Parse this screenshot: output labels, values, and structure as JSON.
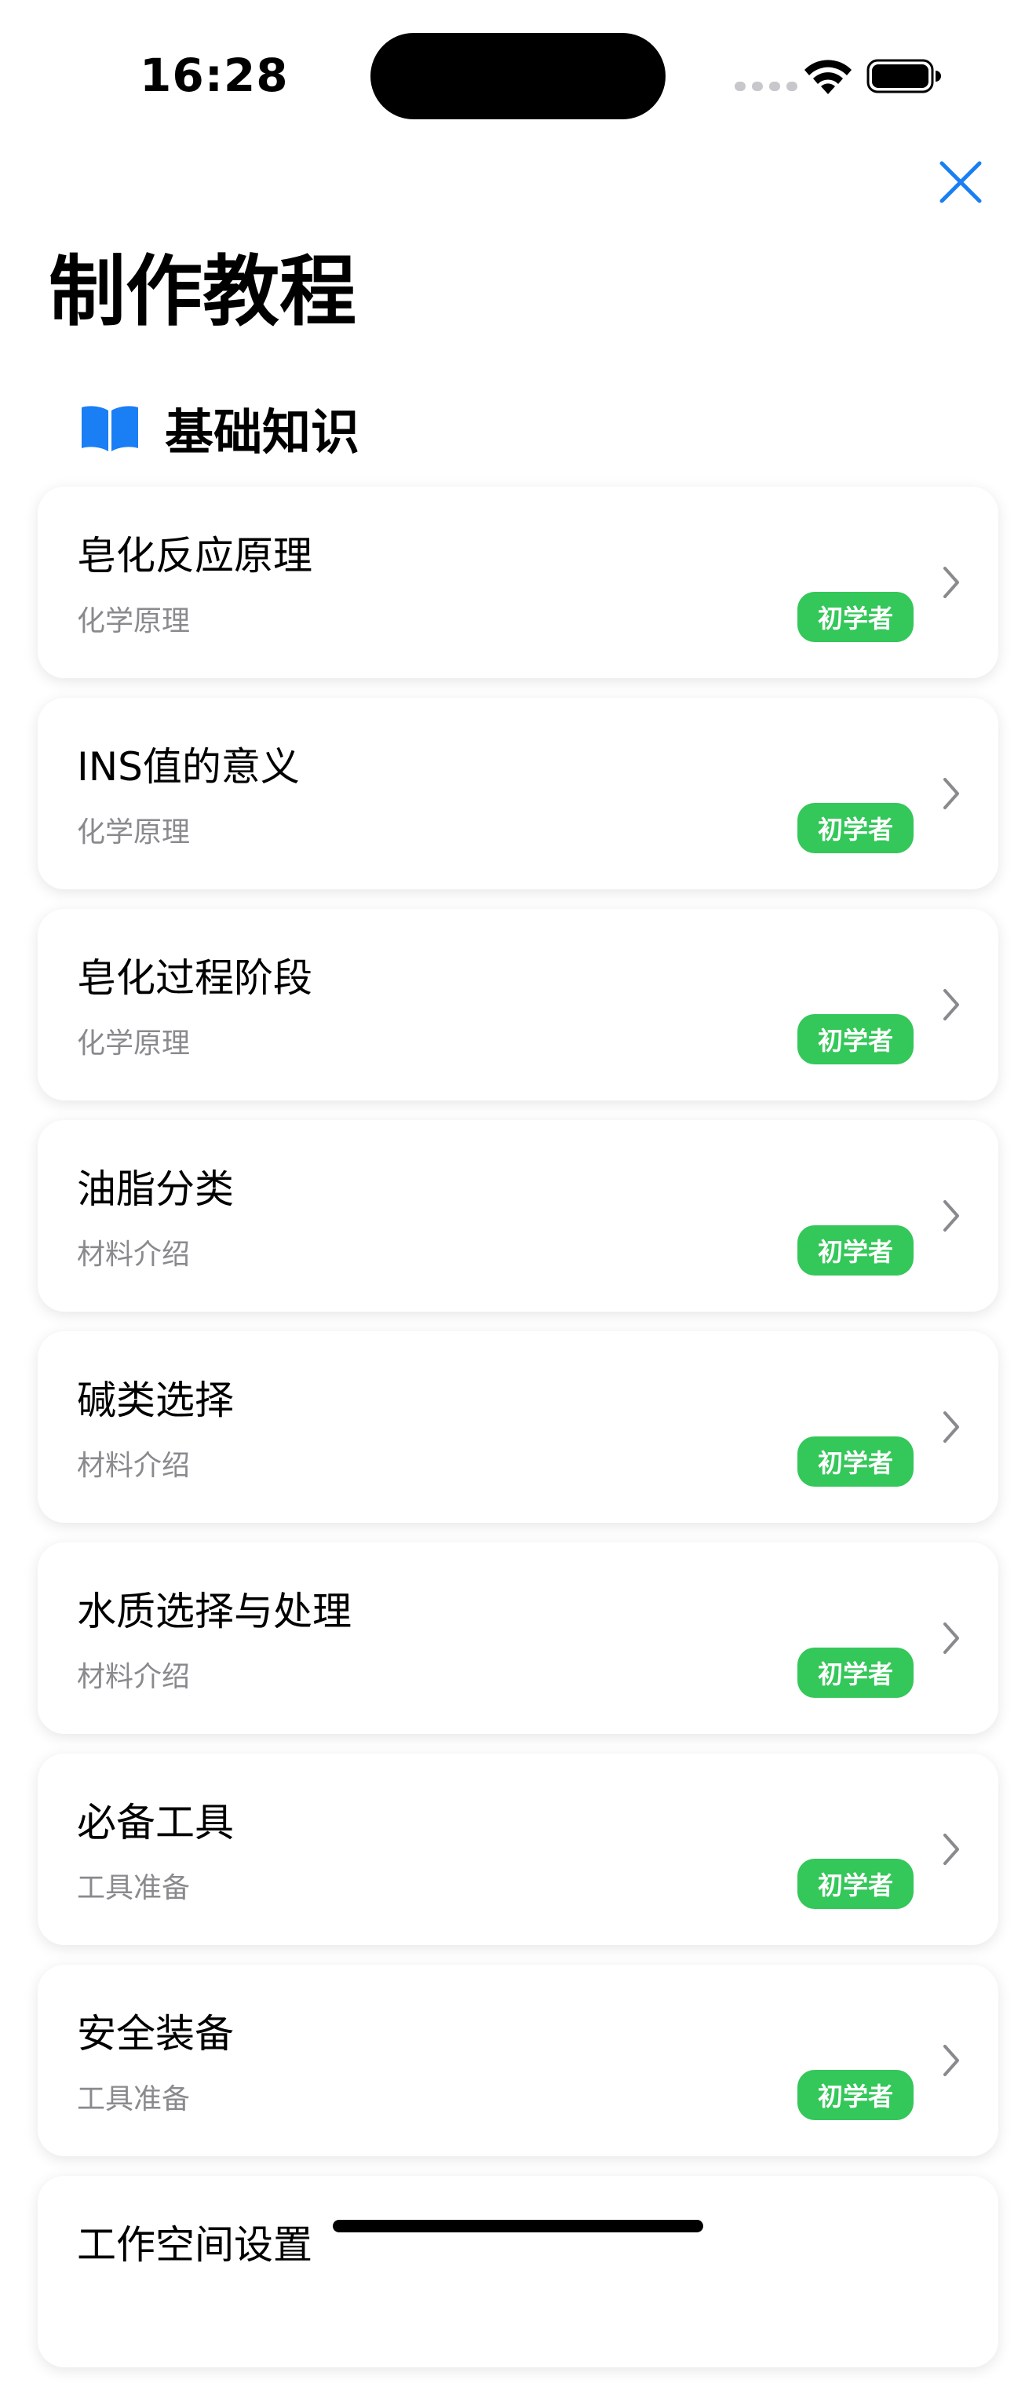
{
  "status_bar": {
    "time": "16:28"
  },
  "header": {
    "title": "制作教程",
    "close_icon": "close-icon"
  },
  "section": {
    "icon": "book-icon",
    "title": "基础知识"
  },
  "colors": {
    "accent": "#1a7ef5",
    "badge": "#34c759",
    "subtitle": "#8a8a8e"
  },
  "tutorials": [
    {
      "title": "皂化反应原理",
      "category": "化学原理",
      "level": "初学者"
    },
    {
      "title": "INS值的意义",
      "category": "化学原理",
      "level": "初学者"
    },
    {
      "title": "皂化过程阶段",
      "category": "化学原理",
      "level": "初学者"
    },
    {
      "title": "油脂分类",
      "category": "材料介绍",
      "level": "初学者"
    },
    {
      "title": "碱类选择",
      "category": "材料介绍",
      "level": "初学者"
    },
    {
      "title": "水质选择与处理",
      "category": "材料介绍",
      "level": "初学者"
    },
    {
      "title": "必备工具",
      "category": "工具准备",
      "level": "初学者"
    },
    {
      "title": "安全装备",
      "category": "工具准备",
      "level": "初学者"
    },
    {
      "title": "工作空间设置",
      "category": "",
      "level": ""
    }
  ]
}
